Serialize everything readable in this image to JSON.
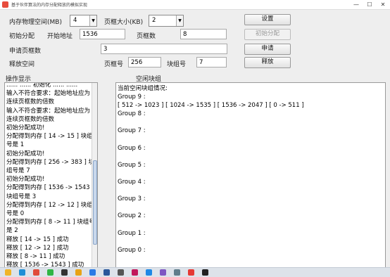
{
  "window": {
    "title": "基于伙伴算法的内存分配释放的模拟实现",
    "minimize": "—",
    "maximize": "☐",
    "close": "✕"
  },
  "config": {
    "memory_label": "内存物理空间(MB)",
    "memory_value": "4",
    "page_size_label": "页框大小(KB)",
    "page_size_value": "2",
    "set_button": "设置"
  },
  "init_row": {
    "label": "初始分配",
    "start_address_label": "开始地址",
    "start_address_value": "1536",
    "page_count_label": "页框数",
    "page_count_value": "8",
    "init_button": "初始分配"
  },
  "request_row": {
    "label": "申请页框数",
    "value": "3",
    "request_button": "申请"
  },
  "release_row": {
    "label": "释放空间",
    "page_number_label": "页框号",
    "page_number_value": "256",
    "block_group_label": "块组号",
    "block_group_value": "7",
    "release_button": "释放"
  },
  "log_panel": {
    "heading": "操作显示",
    "lines": [
      "...... ...... 初始化 ...... ......",
      "输入不符合要求：起始地址应为",
      "连续页框数的倍数",
      "输入不符合要求：起始地址应为",
      "连续页框数的倍数",
      "初始分配成功!",
      "分配得到内存 [ 14 -> 15 ] 块组",
      "号是 1",
      "初始分配成功!",
      "分配得到内存 [ 256 -> 383 ] 块",
      "组号是 7",
      "初始分配成功!",
      "分配得到内存 [ 1536 -> 1543 ]",
      "块组号是 3",
      "分配得到内存 [ 12 -> 12 ] 块组",
      "号是 0",
      "分配得到内存 [ 8 -> 11 ] 块组号",
      "是 2",
      "释放 [ 14 -> 15 ] 成功",
      "释放 [ 12 -> 12 ] 成功",
      "释放 [ 8 -> 11 ] 成功",
      "释放 [ 1536 -> 1543 ] 成功"
    ]
  },
  "free_panel": {
    "heading": "空闲块组",
    "lines": [
      "当前空闲块组情况:",
      "Group 9 :",
      "[ 512 -> 1023 ] [ 1024 -> 1535 ] [ 1536 -> 2047 ] [ 0 -> 511 ]",
      "Group 8 :",
      "",
      "Group 7 :",
      "",
      "Group 6 :",
      "",
      "Group 5 :",
      "",
      "Group 4 :",
      "",
      "Group 3 :",
      "",
      "Group 2 :",
      "",
      "Group 1 :",
      "",
      "Group 0 :"
    ]
  },
  "taskbar": {
    "icons": [
      {
        "name": "file-explorer-icon",
        "color": "#f0b429"
      },
      {
        "name": "edge-icon",
        "color": "#1f8fd6"
      },
      {
        "name": "chrome-icon",
        "color": "#e04b3a"
      },
      {
        "name": "wechat-icon",
        "color": "#2fb545"
      },
      {
        "name": "terminal-icon",
        "color": "#333333"
      },
      {
        "name": "folder-icon",
        "color": "#e8a317"
      },
      {
        "name": "mail-icon",
        "color": "#2c7be5"
      },
      {
        "name": "word-icon",
        "color": "#2b579a"
      },
      {
        "name": "typora-icon",
        "color": "#555555"
      },
      {
        "name": "idea-icon",
        "color": "#c2185b"
      },
      {
        "name": "vscode-icon",
        "color": "#1e88e5"
      },
      {
        "name": "paint-icon",
        "color": "#7e57c2"
      },
      {
        "name": "settings-icon",
        "color": "#607d8b"
      },
      {
        "name": "music-icon",
        "color": "#e53935"
      },
      {
        "name": "java-icon",
        "color": "#222222"
      }
    ]
  }
}
